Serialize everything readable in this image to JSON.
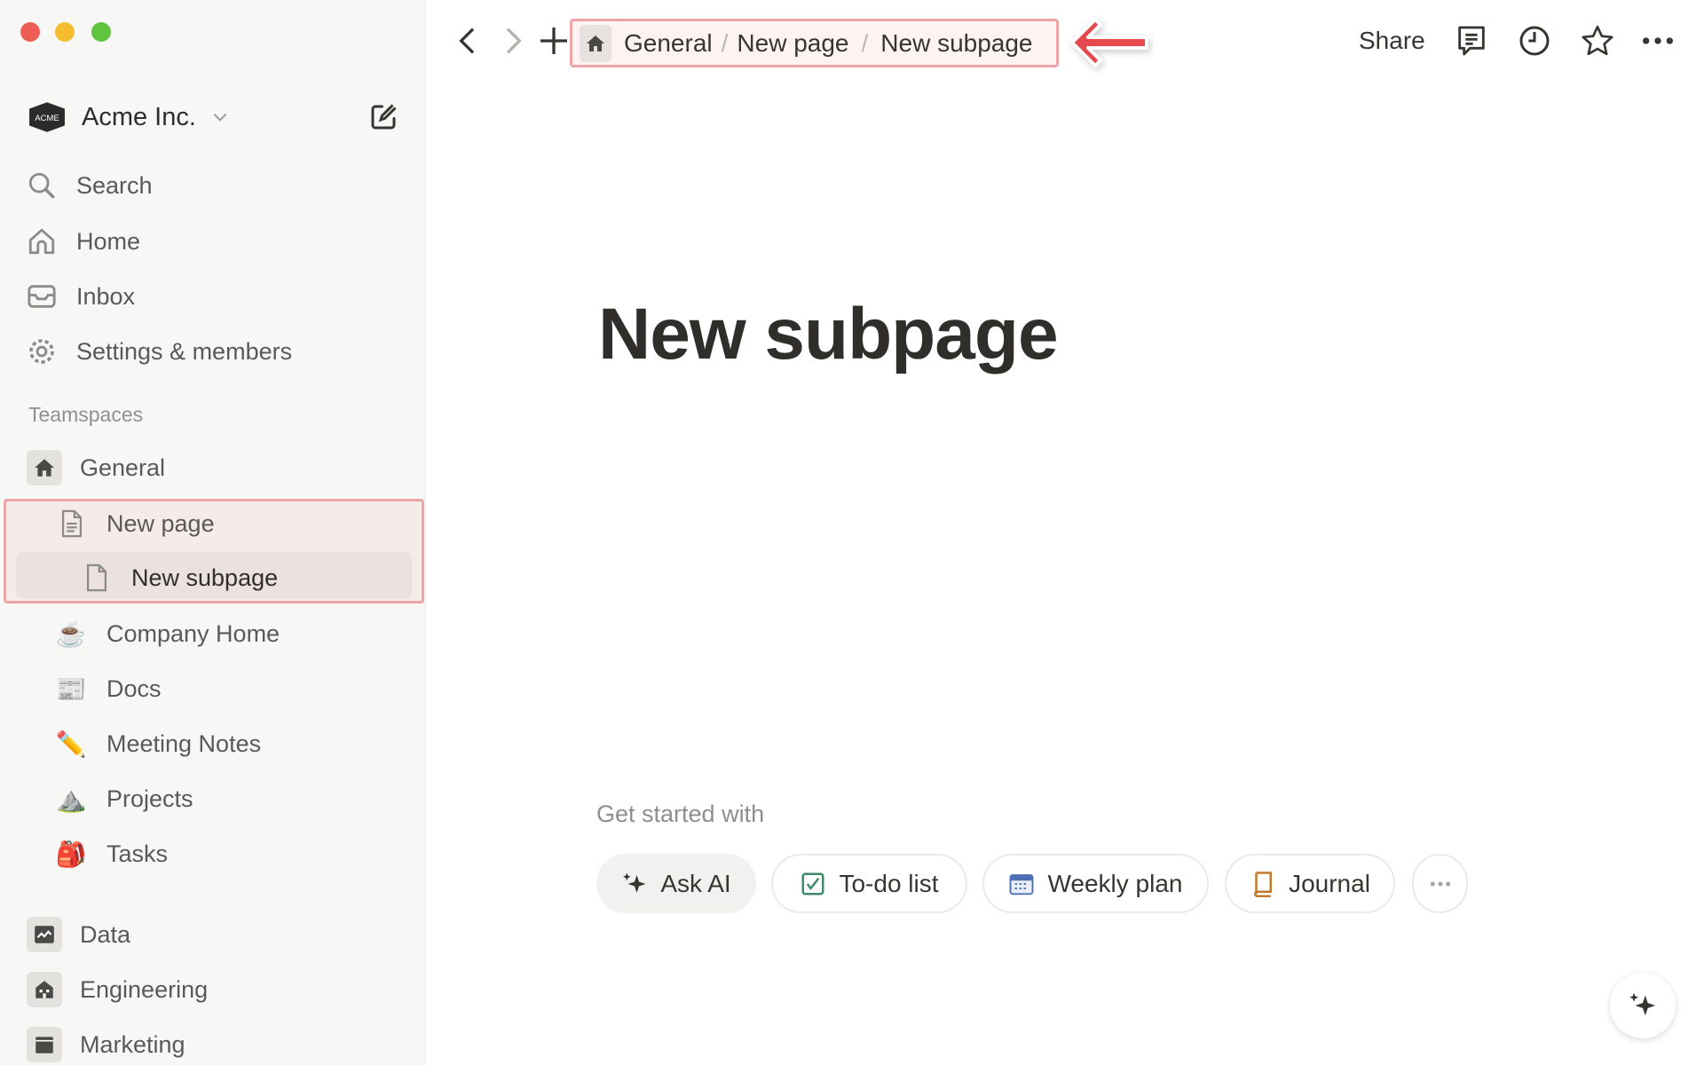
{
  "window": {
    "controls": [
      "close",
      "minimize",
      "maximize"
    ],
    "colors": {
      "close": "#ee5e57",
      "minimize": "#f4bd2f",
      "maximize": "#5fc53f"
    }
  },
  "workspace": {
    "name": "Acme Inc.",
    "logo_text": "ACME"
  },
  "sidebar": {
    "nav": [
      {
        "label": "Search",
        "icon": "search-icon"
      },
      {
        "label": "Home",
        "icon": "home-icon"
      },
      {
        "label": "Inbox",
        "icon": "inbox-icon"
      },
      {
        "label": "Settings & members",
        "icon": "gear-icon"
      }
    ],
    "teamspaces_label": "Teamspaces",
    "general": "General",
    "pages": [
      {
        "label": "New page",
        "icon": "page-icon"
      },
      {
        "label": "New subpage",
        "icon": "page-icon",
        "selected": true
      },
      {
        "label": "Company Home",
        "icon": "☕"
      },
      {
        "label": "Docs",
        "icon": "📰"
      },
      {
        "label": "Meeting Notes",
        "icon": "✏️"
      },
      {
        "label": "Projects",
        "icon": "⛰️"
      },
      {
        "label": "Tasks",
        "icon": "🎒"
      }
    ],
    "teams": [
      {
        "label": "Data",
        "icon": "chart-icon"
      },
      {
        "label": "Engineering",
        "icon": "building-icon"
      },
      {
        "label": "Marketing",
        "icon": "clapper-icon"
      }
    ]
  },
  "topbar": {
    "breadcrumb": [
      "General",
      "New page",
      "New subpage"
    ],
    "share": "Share",
    "highlight_color": "#eda5a8",
    "arrow_color": "#e5484d"
  },
  "page": {
    "title": "New subpage",
    "get_started": "Get started with",
    "templates": [
      {
        "label": "Ask AI",
        "icon": "sparkle-icon"
      },
      {
        "label": "To-do list",
        "icon": "checkbox-icon"
      },
      {
        "label": "Weekly plan",
        "icon": "calendar-icon"
      },
      {
        "label": "Journal",
        "icon": "book-icon"
      }
    ]
  }
}
